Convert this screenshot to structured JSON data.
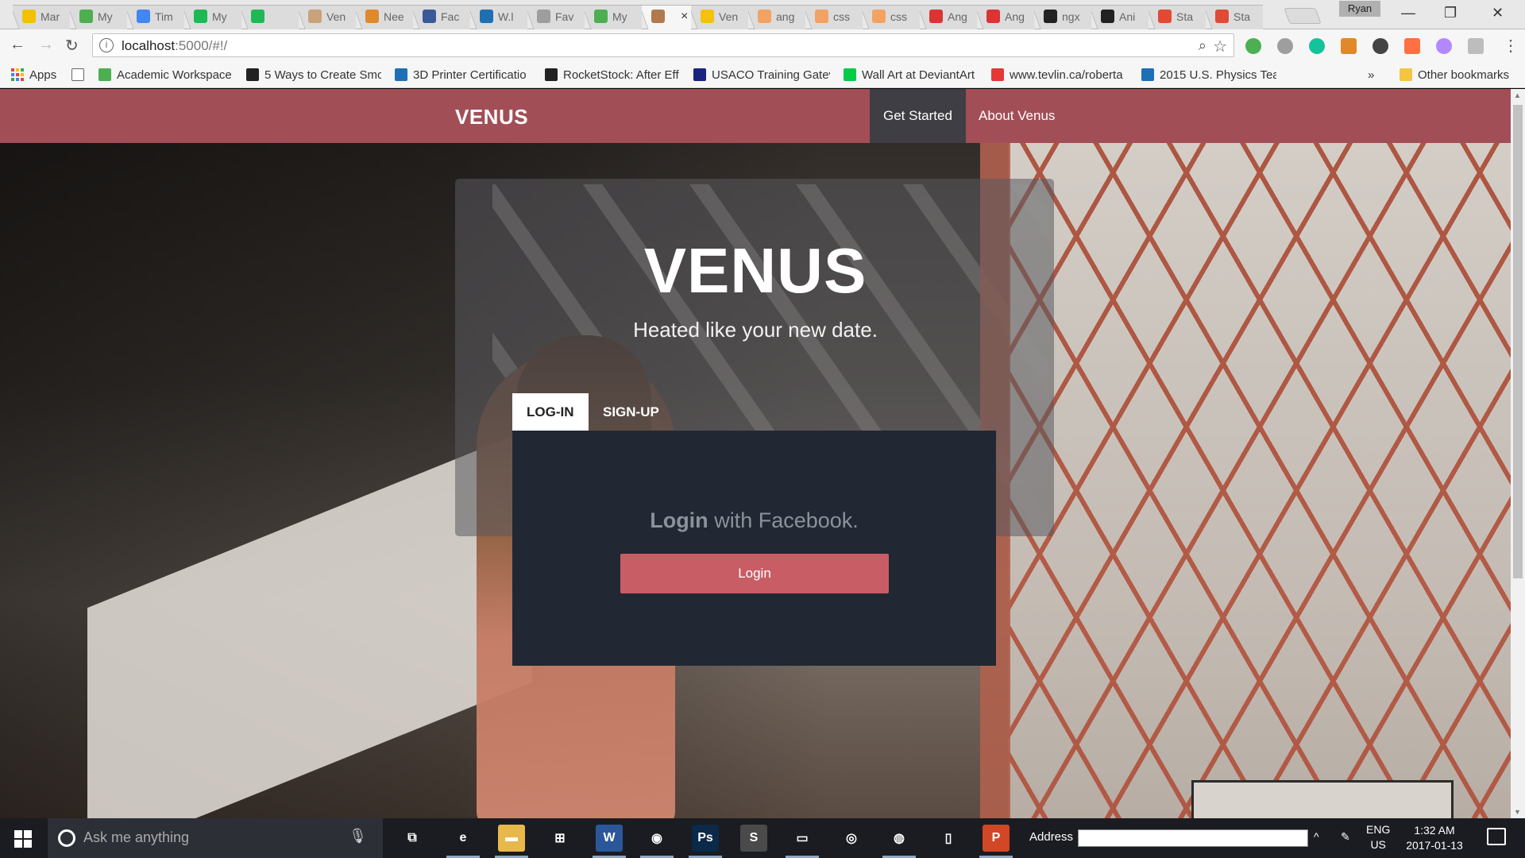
{
  "browser": {
    "tabs": [
      {
        "title": "Mar",
        "color": "#f2c200"
      },
      {
        "title": "My",
        "color": "#4caf50"
      },
      {
        "title": "Tim",
        "color": "#4285f4"
      },
      {
        "title": "My",
        "color": "#1db954"
      },
      {
        "title": "",
        "color": "#1db954"
      },
      {
        "title": "Ven",
        "color": "#c8a27a"
      },
      {
        "title": "Nee",
        "color": "#e0892b"
      },
      {
        "title": "Fac",
        "color": "#3b5998"
      },
      {
        "title": "W.l",
        "color": "#1f6fb5"
      },
      {
        "title": "Fav",
        "color": "#9e9e9e"
      },
      {
        "title": "My",
        "color": "#4caf50"
      },
      {
        "title": "",
        "color": "#b07a4e",
        "active": true
      },
      {
        "title": "Ven",
        "color": "#f4c20d"
      },
      {
        "title": "ang",
        "color": "#f4a261"
      },
      {
        "title": "css",
        "color": "#f4a261"
      },
      {
        "title": "css",
        "color": "#f4a261"
      },
      {
        "title": "Ang",
        "color": "#dd3333"
      },
      {
        "title": "Ang",
        "color": "#dd3333"
      },
      {
        "title": "ngx",
        "color": "#222222"
      },
      {
        "title": "Ani",
        "color": "#222222"
      },
      {
        "title": "Sta",
        "color": "#e24a33"
      },
      {
        "title": "Sta",
        "color": "#e24a33"
      }
    ],
    "active_tab_close": "×",
    "profile_name": "Ryan",
    "url_host": "localhost",
    "url_path": ":5000/#!/",
    "info_glyph": "i",
    "bookmarks": [
      {
        "label": "Apps",
        "icon": "apps-grid-icon"
      },
      {
        "label": "",
        "icon": "page-icon",
        "color": "#ffffff"
      },
      {
        "label": "Academic Workspace",
        "icon": "workspace-icon",
        "color": "#4caf50"
      },
      {
        "label": "5 Ways to Create Smo",
        "icon": "rocketstock-icon",
        "color": "#222222"
      },
      {
        "label": "3D Printer Certificatio",
        "icon": "printer-icon",
        "color": "#1f6fb5"
      },
      {
        "label": "RocketStock: After Eff",
        "icon": "rocketstock-icon",
        "color": "#222222"
      },
      {
        "label": "USACO Training Gatev",
        "icon": "usaco-icon",
        "color": "#1a237e"
      },
      {
        "label": "Wall Art at DeviantArt",
        "icon": "deviantart-icon",
        "color": "#05cc47"
      },
      {
        "label": "www.tevlin.ca/roberta",
        "icon": "tevlin-icon",
        "color": "#e53935"
      },
      {
        "label": "2015 U.S. Physics Tear",
        "icon": "aapt-icon",
        "color": "#1f6fb5"
      }
    ],
    "bookmarks_overflow": "»",
    "other_bookmarks": "Other bookmarks"
  },
  "site": {
    "brand": "VENUS",
    "nav": [
      {
        "label": "Get Started",
        "active": true
      },
      {
        "label": "About Venus",
        "active": false
      }
    ],
    "hero_title": "VENUS",
    "hero_subtitle": "Heated like your new date.",
    "auth_tabs": [
      {
        "label": "LOG-IN",
        "active": true
      },
      {
        "label": "SIGN-UP",
        "active": false
      }
    ],
    "login_prompt_bold": "Login",
    "login_prompt_rest": " with Facebook.",
    "login_button": "Login",
    "colors": {
      "navbar": "#a24e56",
      "card": "#212833",
      "button": "#c85d66"
    }
  },
  "taskbar": {
    "search_placeholder": "Ask me anything",
    "apps": [
      {
        "name": "task-view",
        "glyph": "⧉",
        "color": "#1a1c22"
      },
      {
        "name": "edge",
        "glyph": "e",
        "color": "#1a1c22"
      },
      {
        "name": "file-explorer",
        "glyph": "▬",
        "color": "#e8b84a"
      },
      {
        "name": "store",
        "glyph": "⊞",
        "color": "#1a1c22"
      },
      {
        "name": "word",
        "glyph": "W",
        "color": "#2b579a"
      },
      {
        "name": "chrome",
        "glyph": "◉",
        "color": "#1a1c22"
      },
      {
        "name": "photoshop",
        "glyph": "Ps",
        "color": "#0b2a4a"
      },
      {
        "name": "sublime",
        "glyph": "S",
        "color": "#4a4a4a"
      },
      {
        "name": "terminal",
        "glyph": "▭",
        "color": "#1a1c22"
      },
      {
        "name": "camera",
        "glyph": "◎",
        "color": "#1a1c22"
      },
      {
        "name": "app-circle",
        "glyph": "◍",
        "color": "#1a1c22"
      },
      {
        "name": "notepad",
        "glyph": "▯",
        "color": "#1a1c22"
      },
      {
        "name": "powerpoint",
        "glyph": "P",
        "color": "#d24726"
      }
    ],
    "address_label": "Address",
    "language_top": "ENG",
    "language_bottom": "US",
    "time": "1:32 AM",
    "date": "2017-01-13"
  }
}
